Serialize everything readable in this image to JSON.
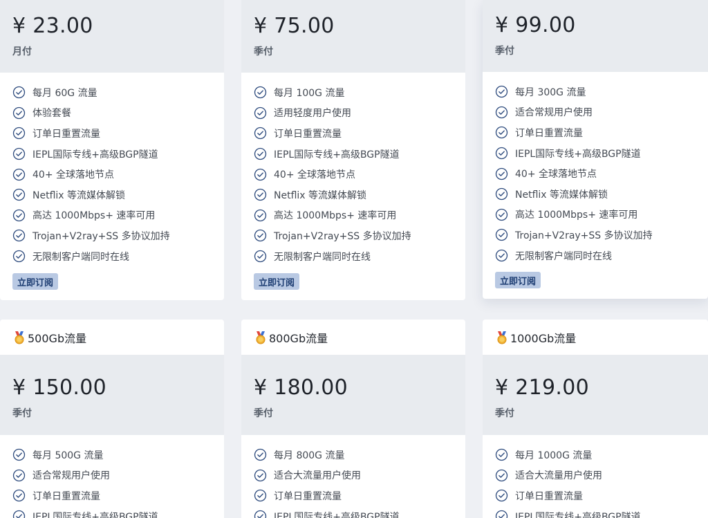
{
  "row1": [
    {
      "price": "¥ 23.00",
      "period": "月付",
      "features": [
        "每月 60G 流量",
        "体验套餐",
        "订单日重置流量",
        "IEPL国际专线+高级BGP隧道",
        "40+ 全球落地节点",
        "Netflix 等流媒体解锁",
        "高达 1000Mbps+ 速率可用",
        "Trojan+V2ray+SS 多协议加持",
        "无限制客户端同时在线"
      ],
      "button": "立即订阅"
    },
    {
      "price": "¥ 75.00",
      "period": "季付",
      "features": [
        "每月 100G 流量",
        "适用轻度用户使用",
        "订单日重置流量",
        "IEPL国际专线+高级BGP隧道",
        "40+ 全球落地节点",
        "Netflix 等流媒体解锁",
        "高达 1000Mbps+ 速率可用",
        "Trojan+V2ray+SS 多协议加持",
        "无限制客户端同时在线"
      ],
      "button": "立即订阅"
    },
    {
      "price": "¥ 99.00",
      "period": "季付",
      "features": [
        "每月 300G 流量",
        "适合常规用户使用",
        "订单日重置流量",
        "IEPL国际专线+高级BGP隧道",
        "40+ 全球落地节点",
        "Netflix 等流媒体解锁",
        "高达 1000Mbps+ 速率可用",
        "Trojan+V2ray+SS 多协议加持",
        "无限制客户端同时在线"
      ],
      "button": "立即订阅"
    }
  ],
  "row2": [
    {
      "title": "500Gb流量",
      "price": "¥ 150.00",
      "period": "季付",
      "features": [
        "每月 500G 流量",
        "适合常规用户使用",
        "订单日重置流量",
        "IEPL国际专线+高级BGP隧道"
      ]
    },
    {
      "title": "800Gb流量",
      "price": "¥ 180.00",
      "period": "季付",
      "features": [
        "每月 800G 流量",
        "适合大流量用户使用",
        "订单日重置流量",
        "IEPL国际专线+高级BGP隧道"
      ]
    },
    {
      "title": "1000Gb流量",
      "price": "¥ 219.00",
      "period": "季付",
      "features": [
        "每月 1000G 流量",
        "适合大流量用户使用",
        "订单日重置流量",
        "IEPL国际专线+高级BGP隧道"
      ]
    }
  ],
  "icons": {
    "feature": "check-circle-icon",
    "plan_title": "medal-icon"
  },
  "colors": {
    "page_bg": "#eef0f4",
    "price_box_bg": "#e8ebef",
    "check_icon": "#2f4c7e",
    "button_bg": "#b9c9e3",
    "button_text": "#1d3d72"
  }
}
